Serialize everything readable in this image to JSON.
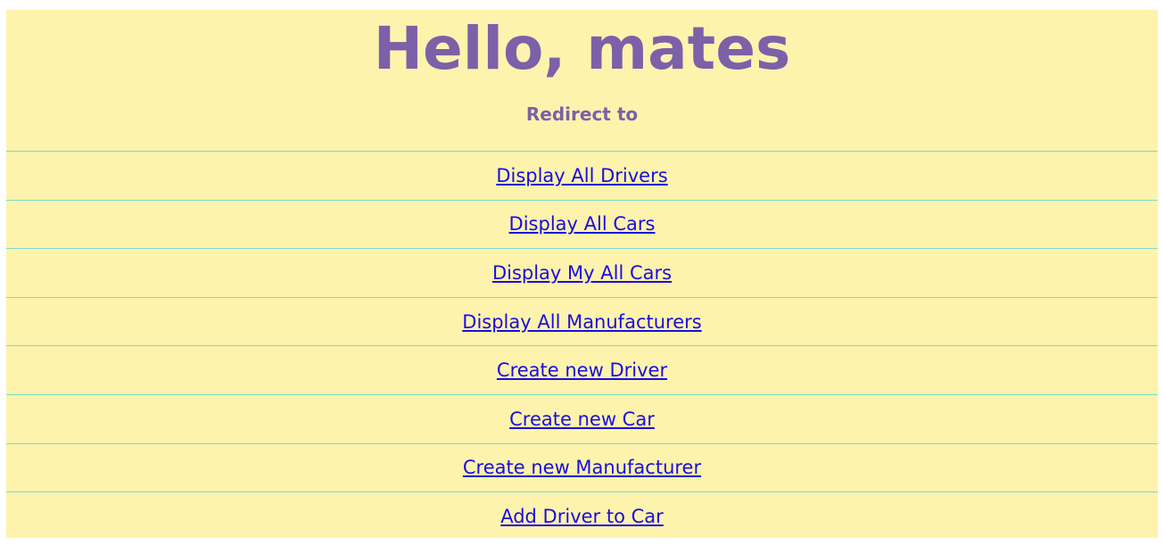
{
  "page": {
    "title": "Hello, mates",
    "subtitle": "Redirect to",
    "colors": {
      "background": "#fdf3ad",
      "heading": "#7c60a8",
      "link": "#1a0de0",
      "divider": "#7fd8c8"
    }
  },
  "links": [
    {
      "label": "Display All Drivers"
    },
    {
      "label": "Display All Cars"
    },
    {
      "label": "Display My All Cars"
    },
    {
      "label": "Display All Manufacturers"
    },
    {
      "label": "Create new Driver"
    },
    {
      "label": "Create new Car"
    },
    {
      "label": "Create new Manufacturer"
    },
    {
      "label": "Add Driver to Car"
    }
  ]
}
